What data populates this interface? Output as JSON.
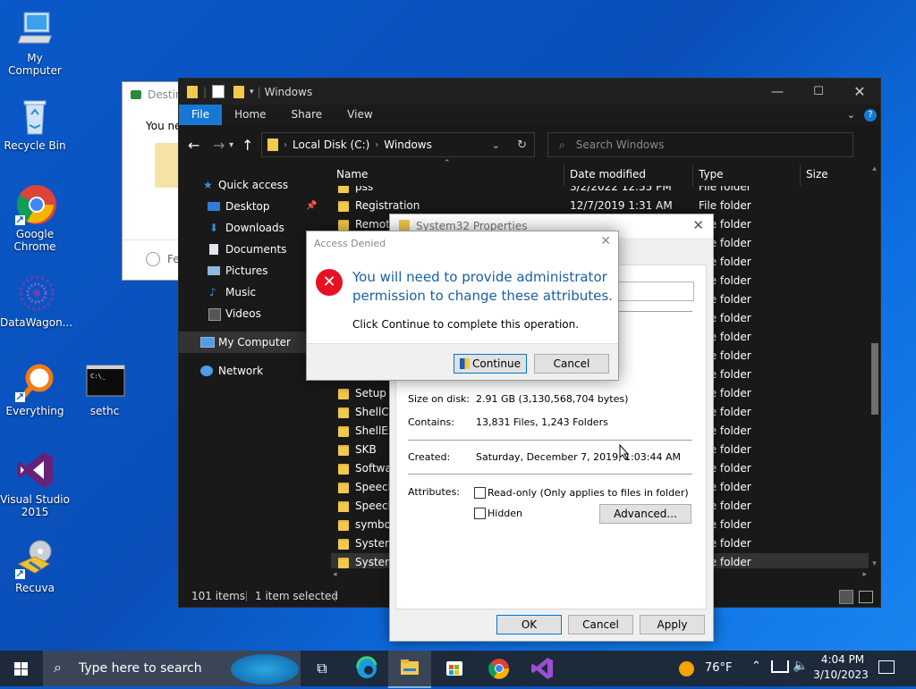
{
  "desktop": {
    "icons": [
      {
        "label": "My Computer"
      },
      {
        "label": "Recycle Bin"
      },
      {
        "label": "Google Chrome"
      },
      {
        "label": "DataWagon..."
      },
      {
        "label": "Everything"
      },
      {
        "label": "sethc"
      },
      {
        "label": "Visual Studio 2015"
      },
      {
        "label": "Recuva"
      }
    ]
  },
  "bg_window": {
    "title": "Destin",
    "body_text": "You ne",
    "footer_text": "Fe"
  },
  "explorer": {
    "title": "Windows",
    "ribbon_tabs": [
      "File",
      "Home",
      "Share",
      "View"
    ],
    "address": {
      "root": "Local Disk (C:)",
      "current": "Windows"
    },
    "search_placeholder": "Search Windows",
    "nav": {
      "quick_access": "Quick access",
      "items": [
        "Desktop",
        "Downloads",
        "Documents",
        "Pictures",
        "Music",
        "Videos"
      ],
      "my_computer": "My Computer",
      "network": "Network"
    },
    "columns": {
      "name": "Name",
      "date": "Date modified",
      "type": "Type",
      "size": "Size"
    },
    "rows": [
      {
        "name": "pss",
        "date": "3/2/2022 12:55 PM",
        "type": "File folder"
      },
      {
        "name": "Registration",
        "date": "12/7/2019 1:31 AM",
        "type": "File folder"
      },
      {
        "name": "Remote",
        "date": "",
        "type": "File folder"
      },
      {
        "name": "",
        "date": "",
        "type": "File folder"
      },
      {
        "name": "",
        "date": "",
        "type": "File folder"
      },
      {
        "name": "",
        "date": "",
        "type": "File folder"
      },
      {
        "name": "",
        "date": "",
        "type": "File folder"
      },
      {
        "name": "",
        "date": "",
        "type": "File folder"
      },
      {
        "name": "",
        "date": "",
        "type": "File folder"
      },
      {
        "name": "",
        "date": "",
        "type": "File folder"
      },
      {
        "name": "",
        "date": "",
        "type": "File folder"
      },
      {
        "name": "Setup",
        "date": "",
        "type": "File folder"
      },
      {
        "name": "ShellCo",
        "date": "",
        "type": "File folder"
      },
      {
        "name": "ShellEx",
        "date": "",
        "type": "File folder"
      },
      {
        "name": "SKB",
        "date": "",
        "type": "File folder"
      },
      {
        "name": "Softwa",
        "date": "",
        "type": "File folder"
      },
      {
        "name": "Speech",
        "date": "",
        "type": "File folder"
      },
      {
        "name": "Speech",
        "date": "",
        "type": "File folder"
      },
      {
        "name": "symbol",
        "date": "",
        "type": "File folder"
      },
      {
        "name": "System",
        "date": "",
        "type": "File folder"
      },
      {
        "name": "System",
        "date": "",
        "type": "File folder"
      }
    ],
    "status": {
      "count": "101 items",
      "selected": "1 item selected"
    }
  },
  "properties": {
    "title": "System32 Properties",
    "size_on_disk_label": "Size on disk:",
    "size_on_disk_value": "2.91 GB (3,130,568,704 bytes)",
    "contains_label": "Contains:",
    "contains_value": "13,831 Files, 1,243 Folders",
    "created_label": "Created:",
    "created_value": "Saturday, December 7, 2019, 1:03:44 AM",
    "attributes_label": "Attributes:",
    "readonly_label": "Read-only (Only applies to files in folder)",
    "hidden_label": "Hidden",
    "advanced_label": "Advanced...",
    "ok_label": "OK",
    "cancel_label": "Cancel",
    "apply_label": "Apply"
  },
  "access_denied": {
    "title": "Access Denied",
    "message_line1": "You will need to provide administrator",
    "message_line2": "permission to change these attributes.",
    "sub": "Click Continue to complete this operation.",
    "continue_label": "Continue",
    "cancel_label": "Cancel"
  },
  "taskbar": {
    "search_placeholder": "Type here to search",
    "weather": "76°F",
    "time": "4:04 PM",
    "date": "3/10/2023"
  },
  "colors": {
    "accent": "#1778d3",
    "error": "#e81123",
    "link_blue": "#1a5fa8"
  }
}
